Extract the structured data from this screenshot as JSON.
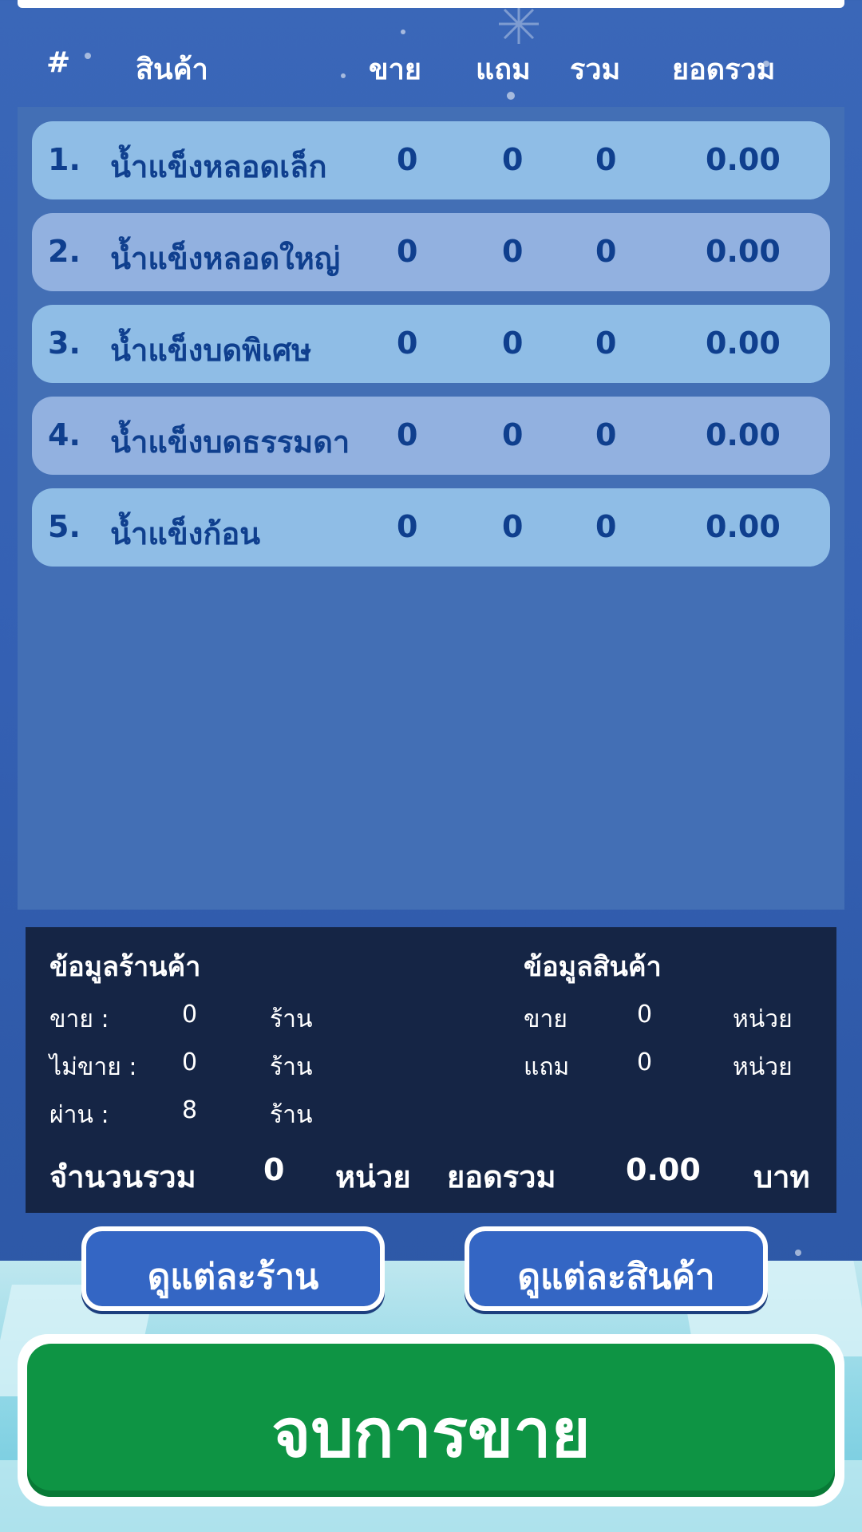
{
  "table": {
    "headers": {
      "index": "#",
      "product": "สินค้า",
      "sell": "ขาย",
      "free": "แถม",
      "total": "รวม",
      "amount": "ยอดรวม"
    },
    "rows": [
      {
        "num": "1.",
        "name": "น้ำแข็งหลอดเล็ก",
        "sell": "0",
        "free": "0",
        "total": "0",
        "amount": "0.00"
      },
      {
        "num": "2.",
        "name": "น้ำแข็งหลอดใหญ่",
        "sell": "0",
        "free": "0",
        "total": "0",
        "amount": "0.00"
      },
      {
        "num": "3.",
        "name": "น้ำแข็งบดพิเศษ",
        "sell": "0",
        "free": "0",
        "total": "0",
        "amount": "0.00"
      },
      {
        "num": "4.",
        "name": "น้ำแข็งบดธรรมดา",
        "sell": "0",
        "free": "0",
        "total": "0",
        "amount": "0.00"
      },
      {
        "num": "5.",
        "name": "น้ำแข็งก้อน",
        "sell": "0",
        "free": "0",
        "total": "0",
        "amount": "0.00"
      }
    ]
  },
  "store_info": {
    "title": "ข้อมูลร้านค้า",
    "lines": [
      {
        "label": "ขาย :",
        "value": "0",
        "unit": "ร้าน"
      },
      {
        "label": "ไม่ขาย :",
        "value": "0",
        "unit": "ร้าน"
      },
      {
        "label": "ผ่าน :",
        "value": "8",
        "unit": "ร้าน"
      }
    ]
  },
  "product_info": {
    "title": "ข้อมูลสินค้า",
    "lines": [
      {
        "label": "ขาย",
        "value": "0",
        "unit": "หน่วย"
      },
      {
        "label": "แถม",
        "value": "0",
        "unit": "หน่วย"
      }
    ]
  },
  "summary": {
    "qty_label": "จำนวนรวม",
    "qty_value": "0",
    "qty_unit": "หน่วย",
    "amount_label": "ยอดรวม",
    "amount_value": "0.00",
    "amount_unit": "บาท"
  },
  "buttons": {
    "view_stores": "ดูแต่ละร้าน",
    "view_products": "ดูแต่ละสินค้า",
    "end_sale": "จบการขาย"
  },
  "colors": {
    "background": "#3460b3",
    "row_light": "#8fbde6",
    "row_alt": "#92b1e0",
    "row_text": "#0f3f8e",
    "info_panel": "#152545",
    "end_button": "#0e9444"
  }
}
